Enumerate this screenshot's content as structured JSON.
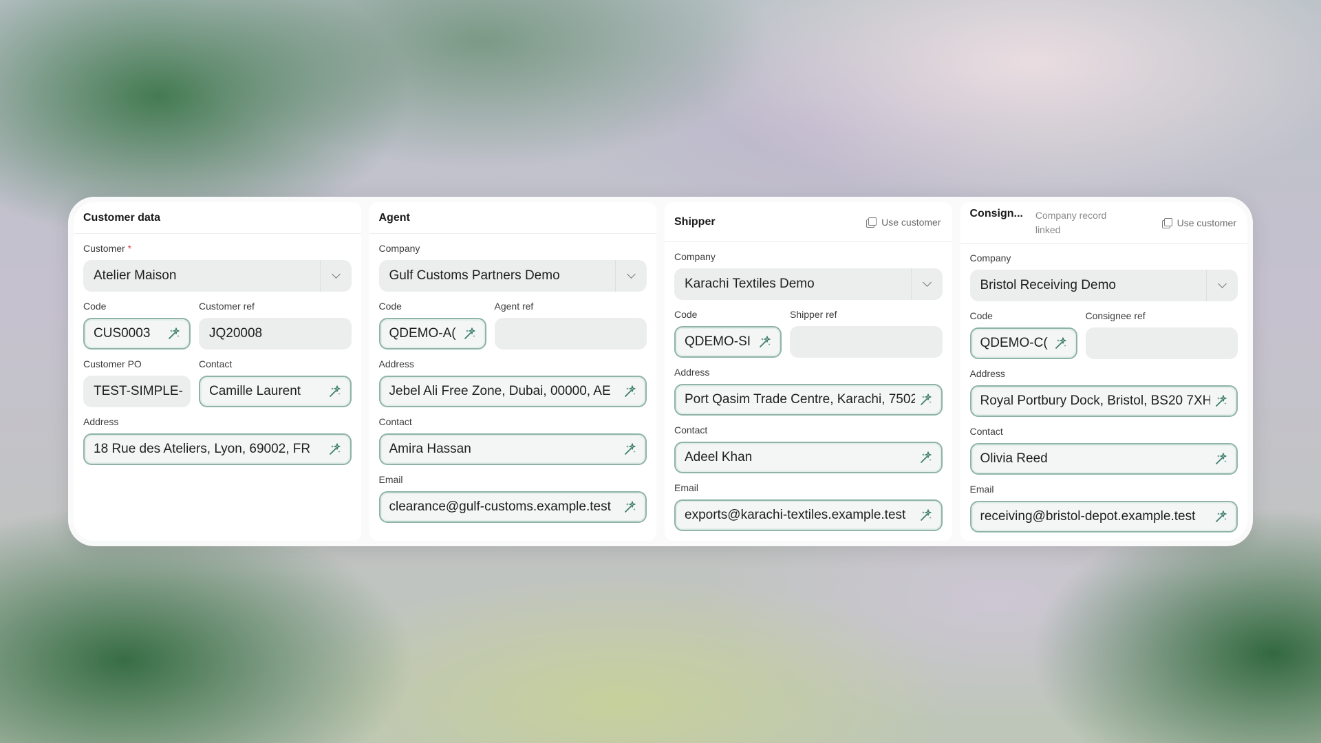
{
  "customer_card": {
    "title": "Customer data",
    "customer_label": "Customer",
    "required_mark": "*",
    "customer_value": "Atelier Maison",
    "code_label": "Code",
    "code_value": "CUS0003",
    "ref_label": "Customer ref",
    "ref_value": "JQ20008",
    "po_label": "Customer PO",
    "po_value": "TEST-SIMPLE-",
    "contact_label": "Contact",
    "contact_value": "Camille Laurent",
    "address_label": "Address",
    "address_value": "18 Rue des Ateliers, Lyon, 69002, FR"
  },
  "agent_card": {
    "title": "Agent",
    "company_label": "Company",
    "company_value": "Gulf Customs Partners Demo",
    "code_label": "Code",
    "code_value": "QDEMO-A(",
    "ref_label": "Agent ref",
    "ref_value": "",
    "address_label": "Address",
    "address_value": "Jebel Ali Free Zone, Dubai, 00000, AE",
    "contact_label": "Contact",
    "contact_value": "Amira Hassan",
    "email_label": "Email",
    "email_value": "clearance@gulf-customs.example.test"
  },
  "shipper_card": {
    "title": "Shipper",
    "use_customer_label": "Use customer",
    "company_label": "Company",
    "company_value": "Karachi Textiles Demo",
    "code_label": "Code",
    "code_value": "QDEMO-SI",
    "ref_label": "Shipper ref",
    "ref_value": "",
    "address_label": "Address",
    "address_value": "Port Qasim Trade Centre, Karachi, 7502(",
    "contact_label": "Contact",
    "contact_value": "Adeel Khan",
    "email_label": "Email",
    "email_value": "exports@karachi-textiles.example.test"
  },
  "consignee_card": {
    "title": "Consign...",
    "linked_note": "Company record linked",
    "use_customer_label": "Use customer",
    "company_label": "Company",
    "company_value": "Bristol Receiving Demo",
    "code_label": "Code",
    "code_value": "QDEMO-C(",
    "ref_label": "Consignee ref",
    "ref_value": "",
    "address_label": "Address",
    "address_value": "Royal Portbury Dock, Bristol, BS20 7XH,",
    "contact_label": "Contact",
    "contact_value": "Olivia Reed",
    "email_label": "Email",
    "email_value": "receiving@bristol-depot.example.test"
  },
  "icons": {
    "ai_fill": "sparkle-wand-icon",
    "dropdown": "chevron-down-icon",
    "copy": "copy-icon"
  },
  "colors": {
    "ai_border": "#8fb3a8",
    "ai_icon": "#3e7d6c",
    "required": "#d94b4b"
  }
}
